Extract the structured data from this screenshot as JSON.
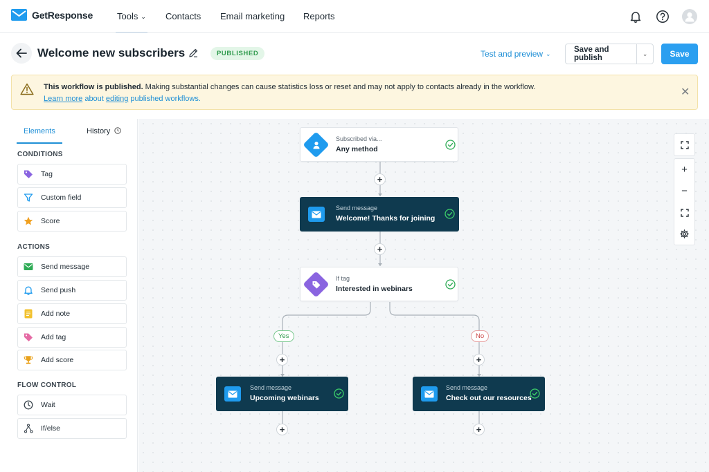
{
  "brand": {
    "name": "GetResponse",
    "accent": "#1f8fd6"
  },
  "topnav": {
    "items": [
      {
        "label": "Tools",
        "has_dropdown": true,
        "active": true
      },
      {
        "label": "Contacts"
      },
      {
        "label": "Email marketing"
      },
      {
        "label": "Reports"
      }
    ],
    "icons": [
      "bell-icon",
      "help-icon",
      "avatar-icon"
    ]
  },
  "header": {
    "title": "Welcome new subscribers",
    "status": "PUBLISHED",
    "test_preview_label": "Test and preview",
    "save_publish_label": "Save and publish",
    "save_label": "Save"
  },
  "banner": {
    "bold": "This workflow is published.",
    "text": " Making substantial changes can cause statistics loss or reset and may not apply to contacts already in the workflow.",
    "link_a": "Learn more",
    "link_mid1": " about ",
    "link_b": "editing",
    "link_mid2": " published workflows."
  },
  "panel": {
    "tabs": [
      {
        "label": "Elements",
        "active": true
      },
      {
        "label": "History"
      }
    ],
    "sections": [
      {
        "title": "CONDITIONS",
        "items": [
          {
            "label": "Tag",
            "icon": "tag-icon"
          },
          {
            "label": "Custom field",
            "icon": "filter-icon"
          },
          {
            "label": "Score",
            "icon": "star-icon"
          }
        ]
      },
      {
        "title": "ACTIONS",
        "items": [
          {
            "label": "Send message",
            "icon": "mail-icon"
          },
          {
            "label": "Send push",
            "icon": "bell-icon"
          },
          {
            "label": "Add note",
            "icon": "note-icon"
          },
          {
            "label": "Add tag",
            "icon": "tag-icon"
          },
          {
            "label": "Add score",
            "icon": "trophy-icon"
          }
        ]
      },
      {
        "title": "FLOW CONTROL",
        "items": [
          {
            "label": "Wait",
            "icon": "clock-icon"
          },
          {
            "label": "If/else",
            "icon": "branch-icon"
          }
        ]
      }
    ]
  },
  "workflow": {
    "nodes": [
      {
        "subtitle": "Subscribed via...",
        "title": "Any method"
      },
      {
        "subtitle": "Send message",
        "title": "Welcome! Thanks for joining"
      },
      {
        "subtitle": "If tag",
        "title": "Interested in webinars"
      },
      {
        "subtitle": "Send message",
        "title": "Upcoming webinars"
      },
      {
        "subtitle": "Send message",
        "title": "Check out our resources"
      }
    ],
    "branches": {
      "yes": "Yes",
      "no": "No"
    },
    "plus": "+"
  },
  "zoom_controls": {
    "zoom_in": "+",
    "zoom_out": "−"
  }
}
